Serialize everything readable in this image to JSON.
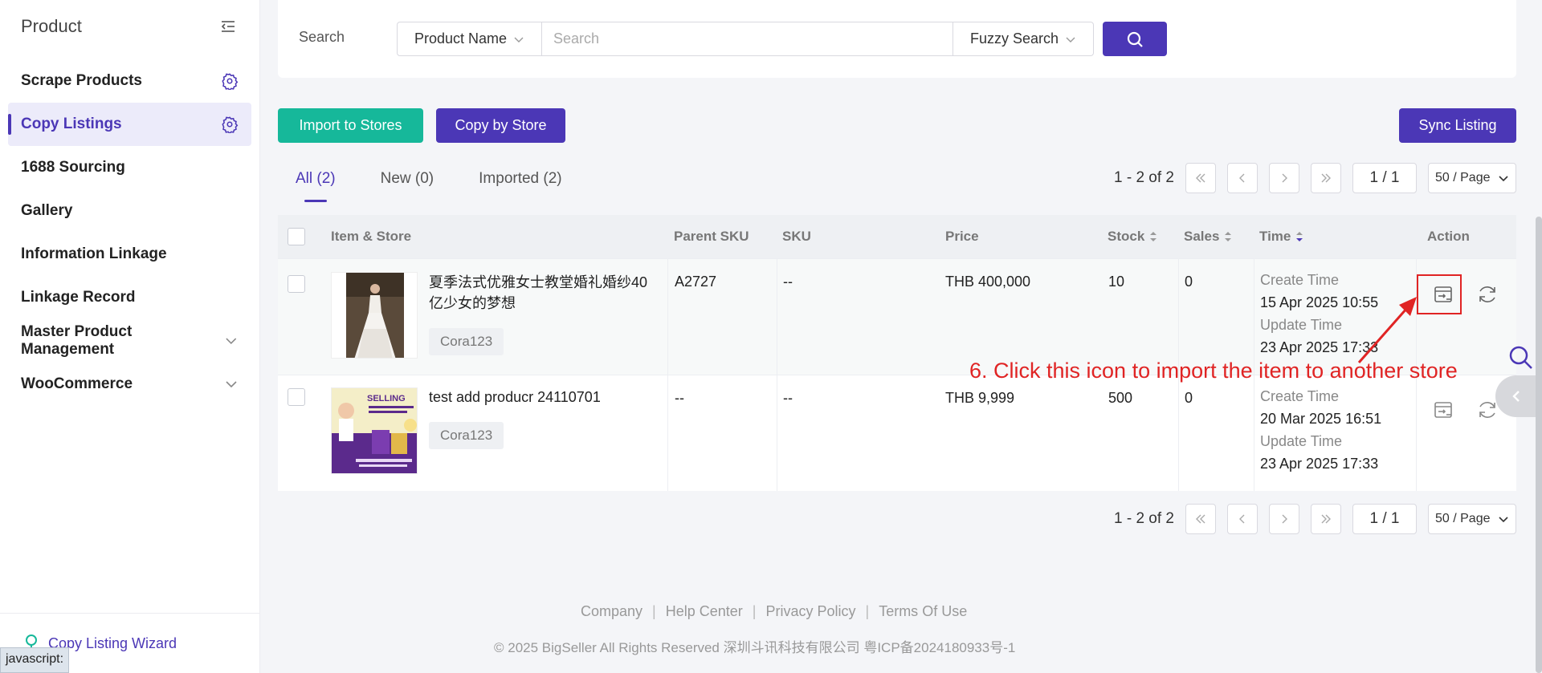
{
  "sidebar": {
    "title": "Product",
    "items": [
      {
        "label": "Scrape Products"
      },
      {
        "label": "Copy Listings"
      },
      {
        "label": "1688 Sourcing"
      },
      {
        "label": "Gallery"
      },
      {
        "label": "Information Linkage"
      },
      {
        "label": "Linkage Record"
      },
      {
        "label": "Master Product Management"
      },
      {
        "label": "WooCommerce"
      }
    ],
    "footer_label": "Copy Listing Wizard"
  },
  "status_bar": "javascript:",
  "search": {
    "label": "Search",
    "field_select": "Product Name",
    "placeholder": "Search",
    "mode_select": "Fuzzy Search"
  },
  "actions": {
    "import_label": "Import to Stores",
    "copy_label": "Copy by Store",
    "sync_label": "Sync Listing"
  },
  "tabs": [
    {
      "label": "All (2)"
    },
    {
      "label": "New (0)"
    },
    {
      "label": "Imported (2)"
    }
  ],
  "pagination": {
    "range": "1 - 2 of 2",
    "page": "1 / 1",
    "page_size": "50 / Page"
  },
  "table": {
    "headers": {
      "item": "Item & Store",
      "parent_sku": "Parent SKU",
      "sku": "SKU",
      "price": "Price",
      "stock": "Stock",
      "sales": "Sales",
      "time": "Time",
      "action": "Action"
    },
    "rows": [
      {
        "title": "夏季法式优雅女士教堂婚礼婚纱40亿少女的梦想",
        "store": "Cora123",
        "parent_sku": "A2727",
        "sku": "--",
        "price": "THB 400,000",
        "stock": "10",
        "sales": "0",
        "create_label": "Create Time",
        "create_time": "15 Apr 2025 10:55",
        "update_label": "Update Time",
        "update_time": "23 Apr 2025 17:33"
      },
      {
        "title": "test add producr 24110701",
        "store": "Cora123",
        "parent_sku": "--",
        "sku": "--",
        "price": "THB 9,999",
        "stock": "500",
        "sales": "0",
        "create_label": "Create Time",
        "create_time": "20 Mar 2025 16:51",
        "update_label": "Update Time",
        "update_time": "23 Apr 2025 17:33"
      }
    ]
  },
  "annotation": "6. Click this icon to import the item to another store",
  "footer": {
    "links": [
      "Company",
      "Help Center",
      "Privacy Policy",
      "Terms Of Use"
    ],
    "copyright": "© 2025 BigSeller All Rights Reserved   深圳斗讯科技有限公司   粤ICP备2024180933号-1"
  },
  "colors": {
    "accent": "#4b37b6",
    "green": "#16b89a",
    "annotation": "#e02424"
  }
}
